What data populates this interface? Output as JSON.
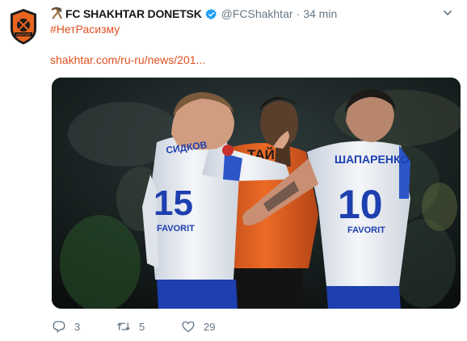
{
  "tweet": {
    "author_name": "FC SHAKHTAR DONETSK",
    "handle": "@FCShakhtar",
    "separator": "·",
    "time": "34 min",
    "hashtag": "#НетРасизму",
    "link": "shakhtar.com/ru-ru/news/201...",
    "avatar_label": "ШАХТАР",
    "media": {
      "left_player": {
        "name": "СИДКОВ",
        "number": "15"
      },
      "center_player": {
        "name": "ТАЙ"
      },
      "right_player": {
        "name": "ШАПАРЕНКО",
        "number": "10"
      },
      "sponsor": "FAVORIT"
    },
    "actions": {
      "reply_count": "3",
      "retweet_count": "5",
      "like_count": "29"
    }
  },
  "colors": {
    "link": "#e0501f",
    "muted": "#657786",
    "verified": "#1da1f2",
    "shakhtar_orange": "#e8641f",
    "dynamo_blue": "#1f3fa8"
  },
  "icons": [
    "shakhtar-logo-icon",
    "mining-tools-icon",
    "verified-icon",
    "chevron-down-icon",
    "reply-icon",
    "retweet-icon",
    "like-icon"
  ]
}
